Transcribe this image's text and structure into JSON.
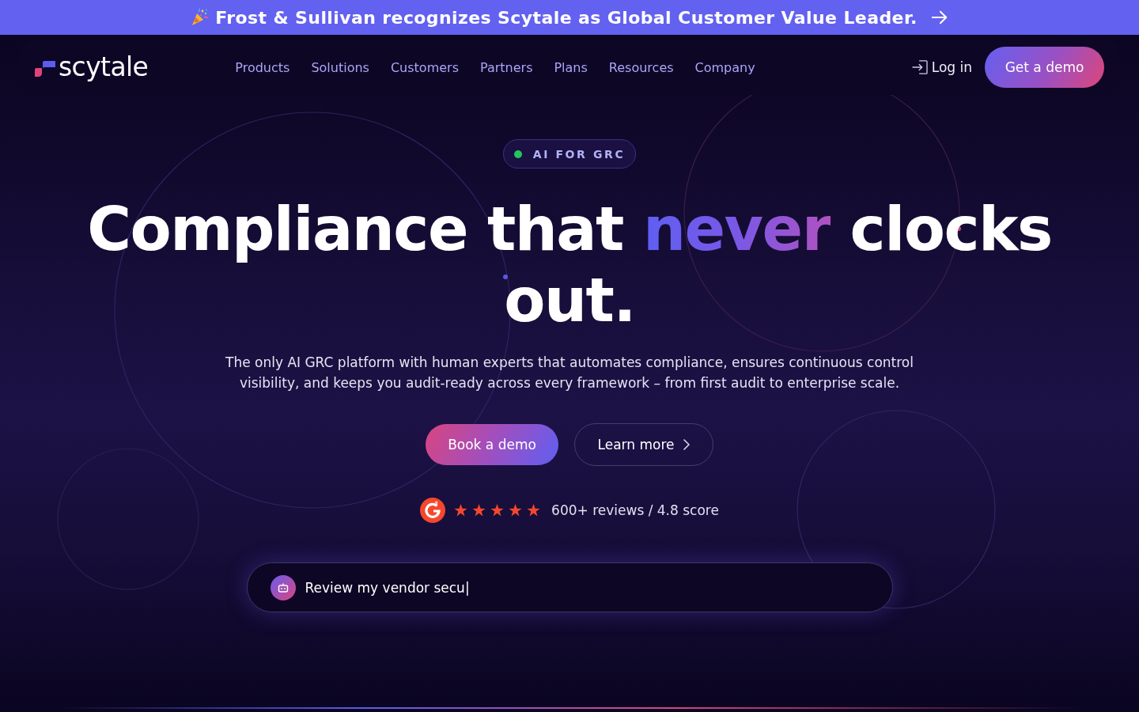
{
  "announcement": {
    "text": "Frost & Sullivan recognizes Scytale as Global Customer Value Leader."
  },
  "nav": {
    "logo": "scytale",
    "items": [
      "Products",
      "Solutions",
      "Customers",
      "Partners",
      "Plans",
      "Resources",
      "Company"
    ],
    "login": "Log in",
    "cta": "Get a demo"
  },
  "hero": {
    "badge": "AI FOR GRC",
    "headline": [
      {
        "text": "Compliance that",
        "highlight": false
      },
      {
        "text": "never",
        "highlight": true
      },
      {
        "text": "clocks out.",
        "highlight": false
      }
    ],
    "description": "The only AI GRC platform with human experts that automates compliance, ensures continuous control visibility, and keeps you audit-ready across every framework – from first audit to enterprise scale.",
    "buttons": [
      {
        "label": "Book a demo",
        "kind": "primary"
      },
      {
        "label": "Learn more",
        "kind": "secondary"
      }
    ],
    "rating": {
      "stars": 5,
      "text": "600+ reviews / 4.8 score"
    },
    "prompt": {
      "value": "Review my vendor secu|"
    }
  }
}
